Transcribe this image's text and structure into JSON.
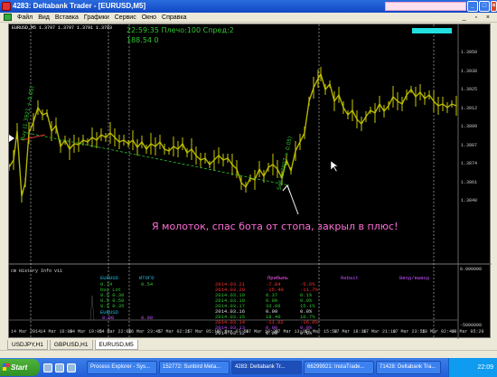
{
  "window": {
    "title": "4283: Deltabank Trader - [EURUSD,M5]",
    "controls": [
      "_",
      "□",
      "×"
    ]
  },
  "menu": {
    "items": [
      "Файл",
      "Вид",
      "Вставка",
      "Графики",
      "Сервис",
      "Окно",
      "Справка"
    ],
    "right_controls": "_ ▫ ×"
  },
  "chart": {
    "symbol_line": "EURUSD,M5  1.3797 1.3797 1.3791 1.3793",
    "info_line": "22:59:35 Плечо:100 Спред:2",
    "info_values": "188.54      0",
    "annotation": "Я молоток, спас бота от стопа, закрыл в плюс!",
    "label_left": "Buy (1.3921 + 0.05)",
    "label_mid": "Sell (1.3907 + 0.05)",
    "price_labels": [
      "1.3950",
      "1.3938",
      "1.3925",
      "1.3912",
      "1.3899",
      "1.3887",
      "1.3874",
      "1.3861",
      "1.3848"
    ],
    "indicator_scale": [
      "0.000000",
      "-5000000"
    ],
    "time_labels": [
      "14 Mar 2014",
      "14 Mar 16:00",
      "14 Mar 19:05",
      "14 Mar 22:00",
      "16 Mar 23:45",
      "17 Mar 02:25",
      "17 Mar 05:10",
      "17 Mar 07:50",
      "17 Mar 10:30",
      "17 Mar 13:10",
      "17 Mar 15:50",
      "17 Mar 18:30",
      "17 Mar 21:10",
      "17 Mar 23:55",
      "18 Mar 02:40",
      "18 Mar 05:20"
    ],
    "colors": {
      "background": "#000000",
      "candles": "#c8c800",
      "vline": "#ffffff",
      "green": "#31c431",
      "annotation": "#ff6fd8"
    }
  },
  "indicator": {
    "name": "cm History Info v11",
    "col1_header": "EURUSD",
    "col1_rows": [
      "0.74",
      "buy  Lot",
      "0.5  0.30",
      "0.5  0.50",
      "0.5  0.35"
    ],
    "col1_b_header": "EURUSD",
    "col1_b_val": "0.00",
    "col2_header": "ИТОГО",
    "col2_val": "0.54",
    "col2_b_val": "0.00",
    "dates": [
      "2014.03.21",
      "2014.03.20",
      "2014.03.19",
      "2014.03.18",
      "2014.03.17",
      "2014.03.16",
      "2014.03.15",
      "2014.03.14",
      "2014.03.13",
      "2014.03.12"
    ],
    "profit_header": "Прибыль",
    "profits": [
      "-7.84",
      "-15.40",
      "0.37",
      "0.00",
      "33.06",
      "0.00",
      "18.40",
      "-11.02",
      "0.00",
      "0.00"
    ],
    "pct": [
      "-5.6%",
      "-11.7%",
      "0.1%",
      "0.0%",
      "15.1%",
      "0.0%",
      "10.7%",
      "-16.0%",
      "0.0%",
      "0.0%"
    ],
    "rebate_header": "Rebait",
    "deposit_header": "Ввод/вывод"
  },
  "tabs": [
    "USDJPY,H1",
    "GBPUSD,H1",
    "EURUSD,M5"
  ],
  "taskbar": {
    "start": "Start",
    "tasks": [
      "Process Explorer - Sys...",
      "152772: Sunbird Meta...",
      "4283: Deltabank Tr...",
      "66299921: InstaTrade...",
      "71428: Deltabank Tra..."
    ],
    "clock": "22:09"
  }
}
